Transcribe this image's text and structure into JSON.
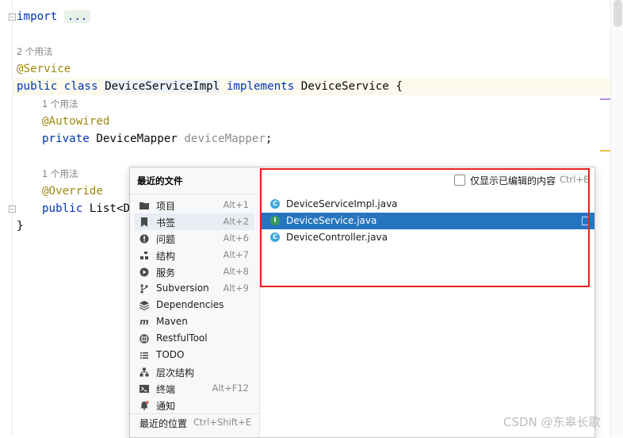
{
  "editor": {
    "import_kw": "import",
    "import_fold": "...",
    "usage_class": "2 个用法",
    "ann_service": "@Service",
    "kw_public": "public",
    "kw_class": "class",
    "class_name": "DeviceServiceImpl",
    "kw_implements": "implements",
    "iface_brace": "DeviceService {",
    "usage_field": "1 个用法",
    "ann_autowired": "@Autowired",
    "kw_private": "private",
    "field_type": "DeviceMapper",
    "field_name": "deviceMapper",
    "semicolon": ";",
    "usage_method": "1 个用法",
    "ann_override": "@Override",
    "method_kw": "public",
    "method_rest": "List<De",
    "close_brace": "}"
  },
  "popup": {
    "title": "最近的文件",
    "nav": [
      {
        "icon": "folder-icon",
        "label": "项目",
        "shortcut": "Alt+1"
      },
      {
        "icon": "bookmark-icon",
        "label": "书签",
        "shortcut": "Alt+2"
      },
      {
        "icon": "problems-icon",
        "label": "问题",
        "shortcut": "Alt+6"
      },
      {
        "icon": "structure-icon",
        "label": "结构",
        "shortcut": "Alt+7"
      },
      {
        "icon": "services-icon",
        "label": "服务",
        "shortcut": "Alt+8"
      },
      {
        "icon": "subversion-icon",
        "label": "Subversion",
        "shortcut": "Alt+9"
      },
      {
        "icon": "dependencies-icon",
        "label": "Dependencies",
        "shortcut": ""
      },
      {
        "icon": "maven-icon",
        "label": "Maven",
        "shortcut": ""
      },
      {
        "icon": "restfultool-icon",
        "label": "RestfulTool",
        "shortcut": ""
      },
      {
        "icon": "todo-icon",
        "label": "TODO",
        "shortcut": ""
      },
      {
        "icon": "hierarchy-icon",
        "label": "层次结构",
        "shortcut": ""
      },
      {
        "icon": "terminal-icon",
        "label": "终端",
        "shortcut": "Alt+F12"
      },
      {
        "icon": "notification-icon",
        "label": "通知",
        "shortcut": ""
      }
    ],
    "selected_nav": "书签",
    "recent_locations": {
      "label": "最近的位置",
      "shortcut": "Ctrl+Shift+E"
    },
    "checkbox": {
      "label": "仅显示已编辑的内容",
      "shortcut": "Ctrl+E",
      "checked": false
    },
    "files": [
      {
        "icon": "class-icon",
        "glyph": "C",
        "color": "#3fa7d9",
        "name": "DeviceServiceImpl.java"
      },
      {
        "icon": "interface-icon",
        "glyph": "I",
        "color": "#3a9b5a",
        "name": "DeviceService.java"
      },
      {
        "icon": "class-icon",
        "glyph": "C",
        "color": "#3fa7d9",
        "name": "DeviceController.java"
      }
    ],
    "selected_file": "DeviceService.java"
  },
  "colors": {
    "selection": "#2675bf",
    "annotation_box": "#e8211e",
    "keyword": "#0033b3",
    "annotation": "#9e880d"
  },
  "watermark": "CSDN @东皋长歌"
}
